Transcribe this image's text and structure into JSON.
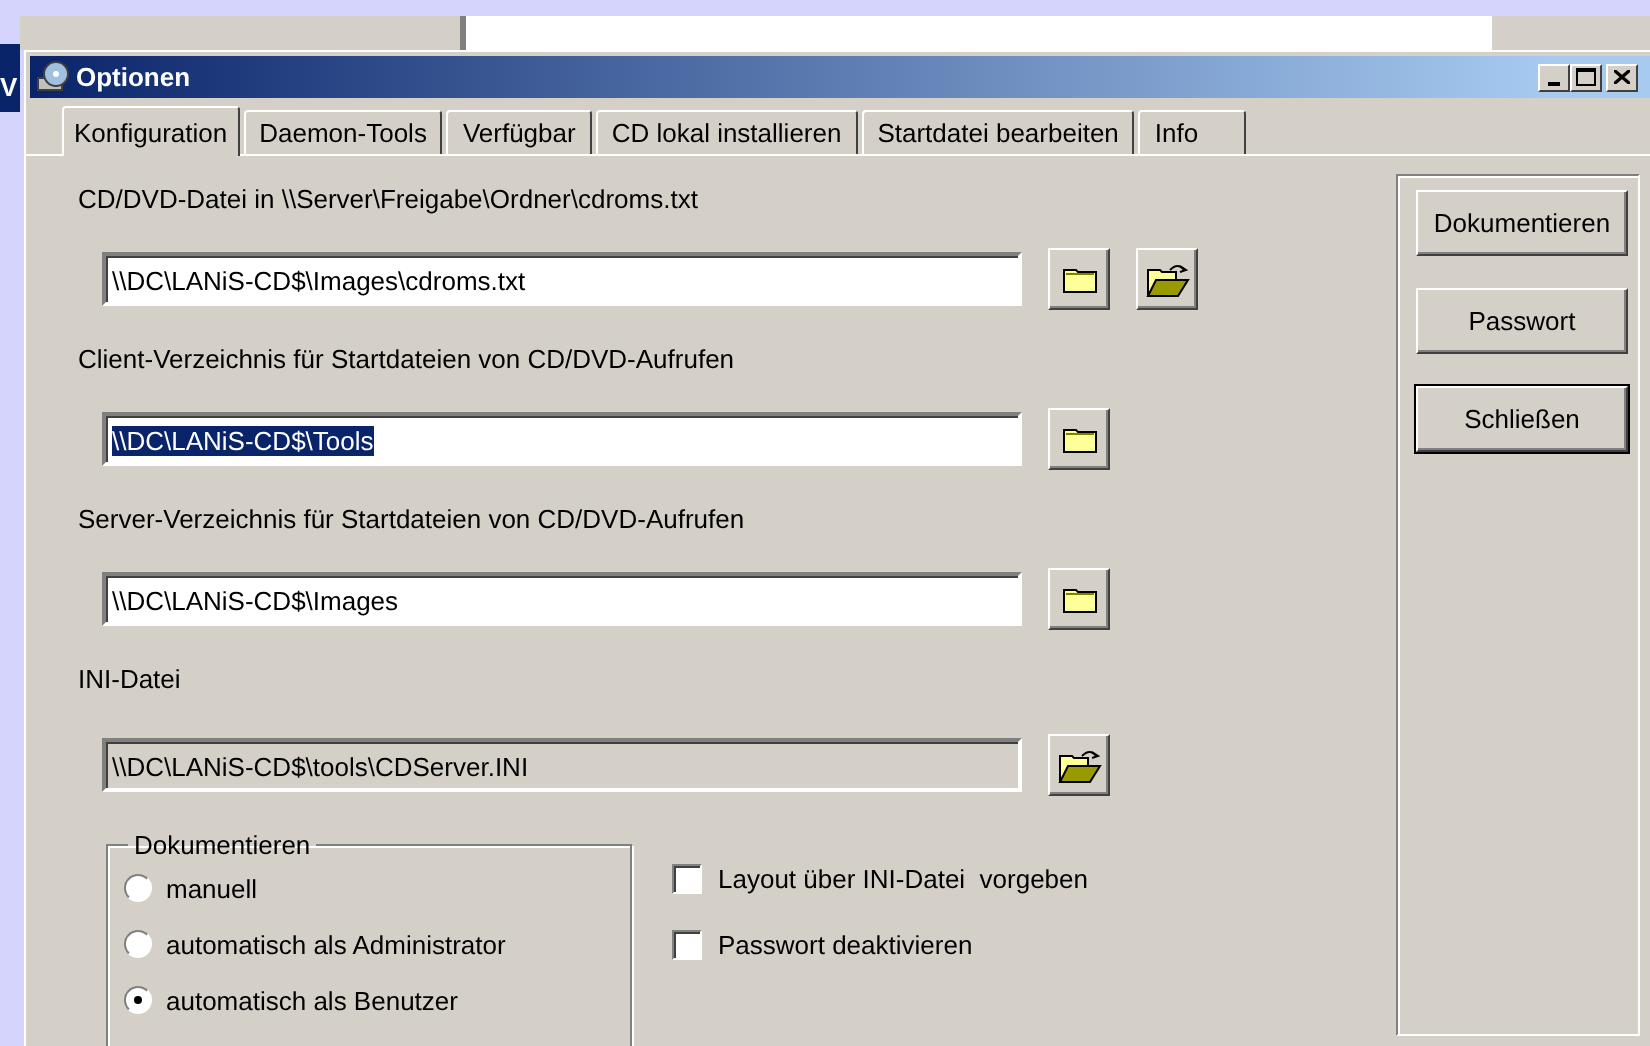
{
  "background_window": {
    "title": "V"
  },
  "window": {
    "title": "Optionen"
  },
  "tabs": [
    {
      "label": "Konfiguration",
      "selected": true
    },
    {
      "label": "Daemon-Tools",
      "selected": false
    },
    {
      "label": "Verfügbar",
      "selected": false
    },
    {
      "label": "CD lokal installieren",
      "selected": false
    },
    {
      "label": "Startdatei bearbeiten",
      "selected": false
    },
    {
      "label": "Info",
      "selected": false
    }
  ],
  "paths": [
    {
      "label": "CD/DVD-Datei in \\\\Server\\Freigabe\\Ordner\\cdroms.txt",
      "value": "\\\\DC\\LANiS-CD$\\Images\\cdroms.txt",
      "disabled": false,
      "text_selected": false,
      "buttons": [
        {
          "kind": "folder"
        },
        {
          "kind": "open-folder"
        }
      ]
    },
    {
      "label": "Client-Verzeichnis für Startdateien von CD/DVD-Aufrufen",
      "value": "\\\\DC\\LANiS-CD$\\Tools",
      "disabled": false,
      "text_selected": true,
      "buttons": [
        {
          "kind": "folder"
        }
      ]
    },
    {
      "label": "Server-Verzeichnis für Startdateien von CD/DVD-Aufrufen",
      "value": "\\\\DC\\LANiS-CD$\\Images",
      "disabled": false,
      "text_selected": false,
      "buttons": [
        {
          "kind": "folder"
        }
      ]
    },
    {
      "label": "INI-Datei",
      "value": "\\\\DC\\LANiS-CD$\\tools\\CDServer.INI",
      "disabled": true,
      "text_selected": false,
      "buttons": [
        {
          "kind": "open-folder"
        }
      ]
    }
  ],
  "document_group": {
    "title": "Dokumentieren",
    "options": [
      {
        "label": "manuell",
        "selected": false
      },
      {
        "label": "automatisch als Administrator",
        "selected": false
      },
      {
        "label": "automatisch als Benutzer",
        "selected": true
      }
    ]
  },
  "checkboxes": [
    {
      "label": "Layout über INI-Datei  vorgeben",
      "checked": false
    },
    {
      "label": "Passwort deaktivieren",
      "checked": false
    }
  ],
  "side_buttons": [
    {
      "label": "Dokumentieren",
      "default": false
    },
    {
      "label": "Passwort",
      "default": false
    },
    {
      "label": "Schließen",
      "default": true
    }
  ]
}
